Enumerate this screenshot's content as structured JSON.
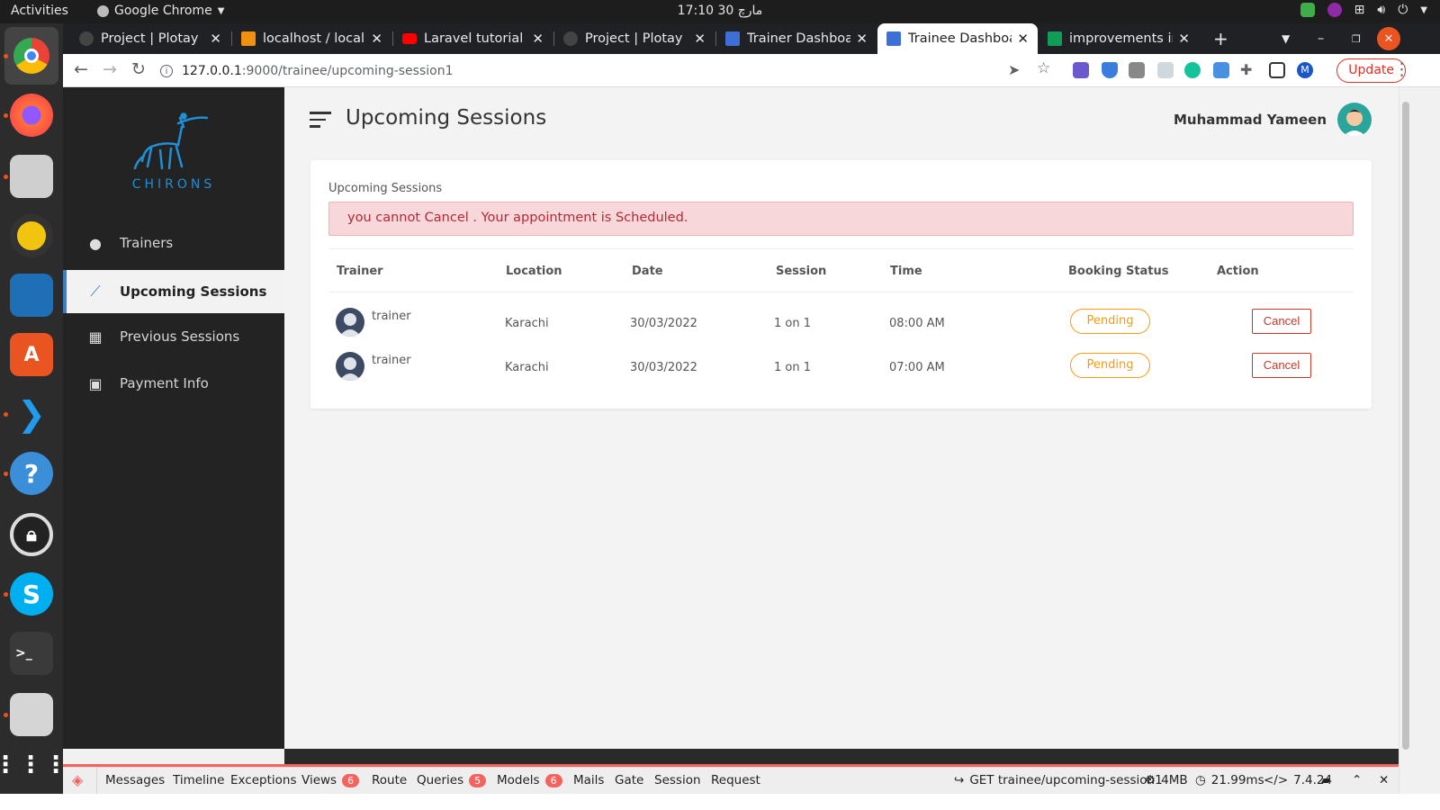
{
  "os": {
    "activities": "Activities",
    "app_name": "Google Chrome",
    "clock": "17:10  مارچ 30"
  },
  "browser": {
    "tabs": [
      {
        "title": "Project | Plotay",
        "color": "#333"
      },
      {
        "title": "localhost / localh",
        "color": "#f29111"
      },
      {
        "title": "Laravel tutorial -",
        "color": "#ff0000"
      },
      {
        "title": "Project | Plotay",
        "color": "#333"
      },
      {
        "title": "Trainer Dashboar",
        "color": "#3d6fd6"
      },
      {
        "title": "Trainee Dashboa",
        "color": "#3d6fd6"
      },
      {
        "title": "improvements in",
        "color": "#0f9d58"
      }
    ],
    "url_host": "127.0.0.1",
    "url_path": ":9000/trainee/upcoming-session1",
    "update_label": "Update",
    "new_tab": "+"
  },
  "sidebar": {
    "logo_text": "CHIRONS",
    "items": [
      {
        "label": "Trainers",
        "icon": "person-icon"
      },
      {
        "label": "Upcoming Sessions",
        "icon": "trend-icon"
      },
      {
        "label": "Previous Sessions",
        "icon": "calendar-icon"
      },
      {
        "label": "Payment Info",
        "icon": "payment-icon"
      }
    ]
  },
  "header": {
    "title": "Upcoming Sessions",
    "user_name": "Muhammad Yameen"
  },
  "card": {
    "title": "Upcoming Sessions",
    "alert": "you cannot Cancel . Your appointment is Scheduled."
  },
  "table": {
    "columns": [
      "Trainer",
      "Location",
      "Date",
      "Session",
      "Time",
      "Booking Status",
      "Action"
    ],
    "rows": [
      {
        "trainer": "trainer",
        "location": "Karachi",
        "date": "30/03/2022",
        "session": "1 on 1",
        "time": "08:00 AM",
        "status": "Pending",
        "action": "Cancel"
      },
      {
        "trainer": "trainer",
        "location": "Karachi",
        "date": "30/03/2022",
        "session": "1 on 1",
        "time": "07:00 AM",
        "status": "Pending",
        "action": "Cancel"
      }
    ]
  },
  "debugbar": {
    "items": [
      {
        "label": "Messages"
      },
      {
        "label": "Timeline"
      },
      {
        "label": "Exceptions"
      },
      {
        "label": "Views",
        "count": "6"
      },
      {
        "label": "Route"
      },
      {
        "label": "Queries",
        "count": "5"
      },
      {
        "label": "Models",
        "count": "6"
      },
      {
        "label": "Mails"
      },
      {
        "label": "Gate"
      },
      {
        "label": "Session"
      },
      {
        "label": "Request"
      }
    ],
    "request": "GET trainee/upcoming-session1",
    "memory": "4MB",
    "time": "21.99ms",
    "php": "7.4.24"
  }
}
